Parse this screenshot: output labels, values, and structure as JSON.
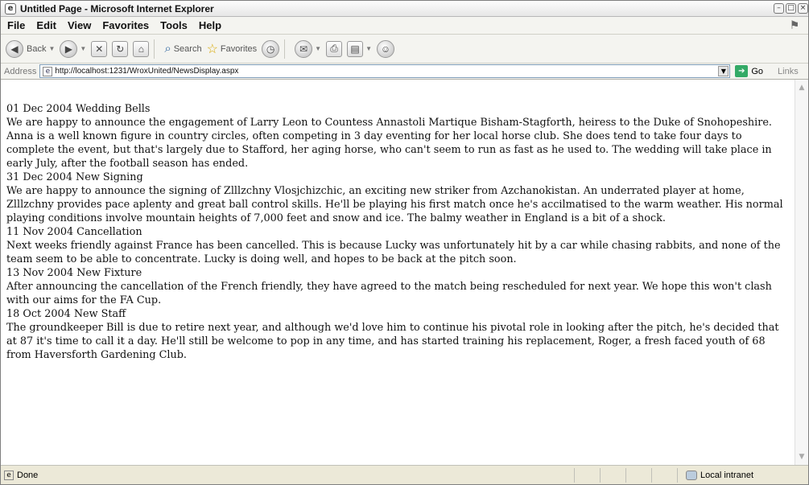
{
  "window": {
    "title": "Untitled Page - Microsoft Internet Explorer"
  },
  "menu": [
    "File",
    "Edit",
    "View",
    "Favorites",
    "Tools",
    "Help"
  ],
  "toolbar": {
    "back": "Back",
    "search": "Search",
    "favorites": "Favorites"
  },
  "address": {
    "label": "Address",
    "url": "http://localhost:1231/WroxUnited/NewsDisplay.aspx",
    "go": "Go",
    "links": "Links"
  },
  "news": [
    {
      "heading": "01 Dec 2004 Wedding Bells",
      "body": "We are happy to announce the engagement of Larry Leon to Countess Annastoli Martique Bisham-Stagforth, heiress to the Duke of Snohopeshire. Anna is a well known figure in country circles, often competing in 3 day eventing for her local horse club. She does tend to take four days to complete the event, but that's largely due to Stafford, her aging horse, who can't seem to run as fast as he used to. The wedding will take place in early July, after the football season has ended."
    },
    {
      "heading": "31 Dec 2004 New Signing",
      "body": "We are happy to announce the signing of Zlllzchny Vlosjchizchic, an exciting new striker from Azchanokistan. An underrated player at home, Zlllzchny provides pace aplenty and great ball control skills. He'll be playing his first match once he's accilmatised to the warm weather. His normal playing conditions involve mountain heights of 7,000 feet and snow and ice. The balmy weather in England is a bit of a shock."
    },
    {
      "heading": "11 Nov 2004 Cancellation",
      "body": "Next weeks friendly against France has been cancelled. This is because Lucky was unfortunately hit by a car while chasing rabbits, and none of the team seem to be able to concentrate. Lucky is doing well, and hopes to be back at the pitch soon."
    },
    {
      "heading": "13 Nov 2004 New Fixture",
      "body": "After announcing the cancellation of the French friendly, they have agreed to the match being rescheduled for next year. We hope this won't clash with our aims for the FA Cup."
    },
    {
      "heading": "18 Oct 2004 New Staff",
      "body": "The groundkeeper Bill is due to retire next year, and although we'd love him to continue his pivotal role in looking after the pitch, he's decided that at 87 it's time to call it a day. He'll still be welcome to pop in any time, and has started training his replacement, Roger, a fresh faced youth of 68 from Haversforth Gardening Club."
    }
  ],
  "status": {
    "text": "Done",
    "zone": "Local intranet"
  }
}
